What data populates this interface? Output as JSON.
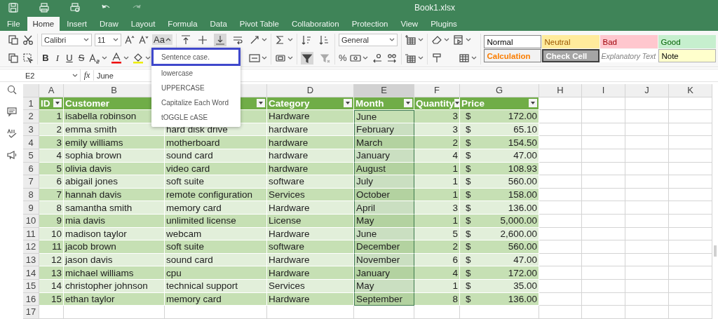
{
  "title_bar": {
    "title": "Book1.xlsx"
  },
  "menu": [
    {
      "label": "File",
      "selected": false
    },
    {
      "label": "Home",
      "selected": true
    },
    {
      "label": "Insert",
      "selected": false
    },
    {
      "label": "Draw",
      "selected": false
    },
    {
      "label": "Layout",
      "selected": false
    },
    {
      "label": "Formula",
      "selected": false
    },
    {
      "label": "Data",
      "selected": false
    },
    {
      "label": "Pivot Table",
      "selected": false
    },
    {
      "label": "Collaboration",
      "selected": false
    },
    {
      "label": "Protection",
      "selected": false
    },
    {
      "label": "View",
      "selected": false
    },
    {
      "label": "Plugins",
      "selected": false
    }
  ],
  "ribbon": {
    "font_name": "Calibri",
    "font_size": "11",
    "case_button": "Aa",
    "format_buttons": [
      {
        "label": "B",
        "kind": "bold"
      },
      {
        "label": "I",
        "kind": "italic"
      },
      {
        "label": "U",
        "kind": "underline"
      },
      {
        "label": "S",
        "kind": "strike"
      }
    ],
    "number_format": "General",
    "percent": "%",
    "cell_styles": [
      {
        "label": "Normal",
        "kind": "normal"
      },
      {
        "label": "Neutral",
        "kind": "neutral"
      },
      {
        "label": "Bad",
        "kind": "bad"
      },
      {
        "label": "Good",
        "kind": "good"
      },
      {
        "label": "Calculation",
        "kind": "calculation"
      },
      {
        "label": "Check Cell",
        "kind": "check"
      },
      {
        "label": "Explanatory Text",
        "kind": "explanatory"
      },
      {
        "label": "Note",
        "kind": "note"
      }
    ]
  },
  "case_menu": [
    {
      "label": "Sentence case.",
      "selected": true
    },
    {
      "label": "lowercase",
      "selected": false
    },
    {
      "label": "UPPERCASE",
      "selected": false
    },
    {
      "label": "Capitalize Each Word",
      "selected": false
    },
    {
      "label": "tOGGLE cASE",
      "selected": false
    }
  ],
  "formula_bar": {
    "cell_ref": "E2",
    "fx": "fx",
    "value": "June"
  },
  "sheet": {
    "columns": [
      {
        "label": "A",
        "selected": false
      },
      {
        "label": "B",
        "selected": false
      },
      {
        "selected": false
      },
      {
        "label": "D",
        "selected": false
      },
      {
        "label": "E",
        "selected": true
      },
      {
        "label": "F",
        "selected": false
      },
      {
        "label": "G",
        "selected": false
      },
      {
        "label": "H",
        "selected": false
      },
      {
        "label": "I",
        "selected": false
      },
      {
        "label": "J",
        "selected": false
      },
      {
        "label": "K",
        "selected": false
      }
    ],
    "row_numbers": [
      "1",
      "2",
      "3",
      "4",
      "5",
      "6",
      "7",
      "8",
      "9",
      "10",
      "11",
      "12",
      "13",
      "14",
      "15",
      "16",
      "17"
    ],
    "header_cells": [
      {
        "label": "ID",
        "filter": true
      },
      {
        "label": "Customer",
        "filter": false
      },
      {
        "filter": true
      },
      {
        "label": "Category",
        "filter": true
      },
      {
        "label": "Month",
        "filter": true
      },
      {
        "label": "Quantity",
        "filter": true
      },
      {
        "label": "Price",
        "filter": true
      }
    ],
    "rows": [
      {
        "id": "1",
        "customer": "isabella robinson",
        "category": "Hardware",
        "month": "June",
        "active": true,
        "quantity": "3",
        "currency": "$",
        "price": "172.00"
      },
      {
        "id": "2",
        "customer": "emma smith",
        "product": "hard disk drive",
        "category": "hardware",
        "month": "February",
        "active": false,
        "quantity": "3",
        "currency": "$",
        "price": "65.10"
      },
      {
        "id": "3",
        "customer": "emily williams",
        "product": "motherboard",
        "category": "hardware",
        "month": "March",
        "active": false,
        "quantity": "2",
        "currency": "$",
        "price": "154.50"
      },
      {
        "id": "4",
        "customer": "sophia brown",
        "product": "sound card",
        "category": "hardware",
        "month": "January",
        "active": false,
        "quantity": "4",
        "currency": "$",
        "price": "47.00"
      },
      {
        "id": "5",
        "customer": "olivia davis",
        "product": "video card",
        "category": "hardware",
        "month": "August",
        "active": false,
        "quantity": "1",
        "currency": "$",
        "price": "108.93"
      },
      {
        "id": "6",
        "customer": "abigail jones",
        "product": "soft suite",
        "category": "software",
        "month": "July",
        "active": false,
        "quantity": "1",
        "currency": "$",
        "price": "560.00"
      },
      {
        "id": "7",
        "customer": "hannah davis",
        "product": "remote configuration",
        "category": "Services",
        "month": "October",
        "active": false,
        "quantity": "1",
        "currency": "$",
        "price": "158.00"
      },
      {
        "id": "8",
        "customer": "samantha smith",
        "product": "memory card",
        "category": "Hardware",
        "month": "April",
        "active": false,
        "quantity": "3",
        "currency": "$",
        "price": "136.00"
      },
      {
        "id": "9",
        "customer": "mia davis",
        "product": "unlimited license",
        "category": "License",
        "month": "May",
        "active": false,
        "quantity": "1",
        "currency": "$",
        "price": "5,000.00"
      },
      {
        "id": "10",
        "customer": "madison taylor",
        "product": "webcam",
        "category": "Hardware",
        "month": "June",
        "active": false,
        "quantity": "5",
        "currency": "$",
        "price": "2,600.00"
      },
      {
        "id": "11",
        "customer": "jacob brown",
        "product": "soft suite",
        "category": "software",
        "month": "December",
        "active": false,
        "quantity": "2",
        "currency": "$",
        "price": "560.00"
      },
      {
        "id": "12",
        "customer": "jason davis",
        "product": "sound card",
        "category": "Hardware",
        "month": "November",
        "active": false,
        "quantity": "6",
        "currency": "$",
        "price": "47.00"
      },
      {
        "id": "13",
        "customer": "michael williams",
        "product": "cpu",
        "category": "Hardware",
        "month": "January",
        "active": false,
        "quantity": "4",
        "currency": "$",
        "price": "172.00"
      },
      {
        "id": "14",
        "customer": "christopher johnson",
        "product": "technical support",
        "category": "Services",
        "month": "May",
        "active": false,
        "quantity": "1",
        "currency": "$",
        "price": "35.00"
      },
      {
        "id": "15",
        "customer": "ethan taylor",
        "product": "memory card",
        "category": "Hardware",
        "month": "September",
        "active": false,
        "quantity": "8",
        "currency": "$",
        "price": "136.00"
      }
    ]
  }
}
